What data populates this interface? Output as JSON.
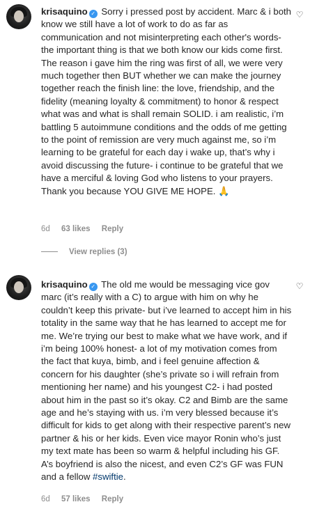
{
  "comments": [
    {
      "username": "krisaquino",
      "text": "Sorry i pressed post by accident. Marc & i both know we still have a lot of work to do as far as communication and not misinterpreting each other's words- the important thing is that we both know our kids come first. The reason i gave him the ring was first of all, we were very much together then BUT whether we can make the journey together reach the finish line: the love, friendship, and the fidelity (meaning loyalty & commitment) to honor & respect what was and what is shall remain SOLID. i am realistic, i’m battling 5 autoimmune conditions and the odds of me getting to the point of remission are very much against me, so i’m learning to be grateful for each day i wake up, that’s why i avoid discussing the future- i continue to be grateful that we have a merciful & loving God who listens to your prayers. Thank you because YOU GIVE ME HOPE. 🙏",
      "time": "6d",
      "likes": "63 likes",
      "reply": "Reply",
      "view_replies": "View replies (3)"
    },
    {
      "username": "krisaquino",
      "text": "The old me would be messaging vice gov marc (it’s really with a C) to argue with him on why he couldn’t keep this private- but i’ve learned to accept him in his totality in the same way that he has learned to accept me for me. We’re trying our best to make what we have work, and if i’m being 100% honest- a lot of my motivation comes from the fact that kuya, bimb, and i feel genuine affection & concern for his daughter (she’s private so i will refrain from mentioning her name) and his youngest C2- i had posted about him in the past so it’s okay. C2 and Bimb are the same age and he’s staying with us. i’m very blessed because it’s difficult for kids to get along with their respective parent’s new partner & his or her kids. Even vice mayor Ronin who’s just my text mate has been so warm & helpful including his GF. A’s boyfriend is also the nicest, and even C2’s GF was FUN and a fellow ",
      "hashtag": "#swiftie",
      "text_end": ".",
      "time": "6d",
      "likes": "57 likes",
      "reply": "Reply"
    }
  ]
}
